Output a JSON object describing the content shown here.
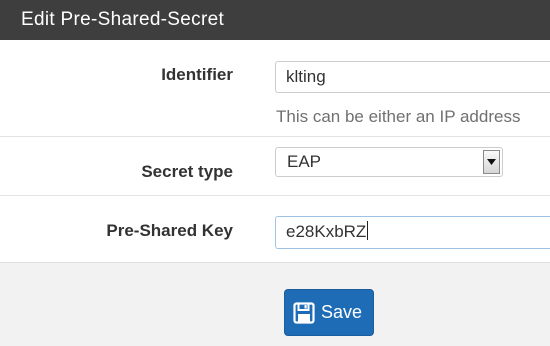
{
  "panel": {
    "title": "Edit Pre-Shared-Secret"
  },
  "form": {
    "identifier": {
      "label": "Identifier",
      "value": "klting",
      "help": "This can be either an IP address"
    },
    "secret_type": {
      "label": "Secret type",
      "selected": "EAP"
    },
    "pre_shared_key": {
      "label": "Pre-Shared Key",
      "value": "e28KxbRZ"
    }
  },
  "actions": {
    "save_label": "Save",
    "save_icon": "floppy-disk-icon"
  },
  "colors": {
    "header_bg": "#3e3e3e",
    "primary_button": "#1f6cb6",
    "page_bg": "#f2f2f2"
  }
}
